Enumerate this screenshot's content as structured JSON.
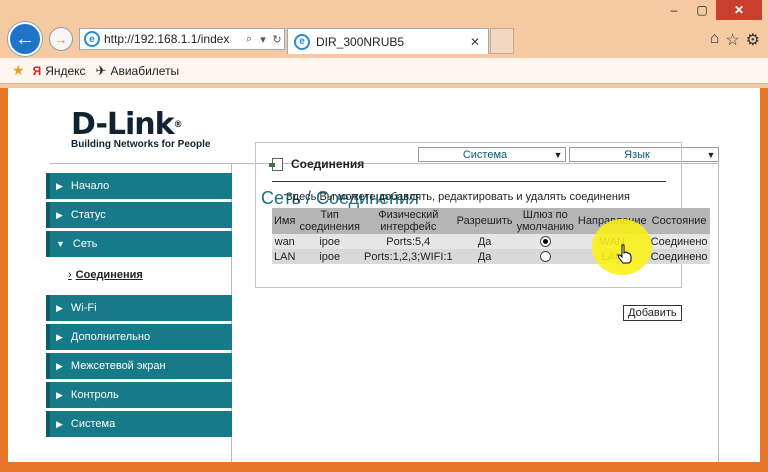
{
  "browser": {
    "url": "http://192.168.1.1/index",
    "tab_title": "DIR_300NRUB5",
    "favorites": [
      "Яндекс",
      "Авиабилеты"
    ]
  },
  "logo": {
    "brand": "D-Link",
    "tagline": "Building Networks for People"
  },
  "selects": {
    "system": "Система",
    "language": "Язык"
  },
  "sidebar": {
    "items": [
      {
        "label": "Начало"
      },
      {
        "label": "Статус"
      },
      {
        "label": "Сеть"
      },
      {
        "label": "Wi-Fi"
      },
      {
        "label": "Дополнительно"
      },
      {
        "label": "Межсетевой экран"
      },
      {
        "label": "Контроль"
      },
      {
        "label": "Система"
      }
    ],
    "subitem": "Соединения"
  },
  "page_heading": "Сеть  / Соединения",
  "panel": {
    "title": "Соединения",
    "description": "Здесь Вы можете добавлять, редактировать и удалять соединения"
  },
  "table": {
    "headers": [
      "Имя",
      "Тип соединения",
      "Физический интерфейс",
      "Разрешить",
      "Шлюз по умолчанию",
      "Направление",
      "Состояние"
    ],
    "rows": [
      {
        "name": "wan",
        "type": "ipoe",
        "iface": "Ports:5,4",
        "enabled": "Да",
        "gateway": true,
        "direction": "WAN",
        "state": "Соединено"
      },
      {
        "name": "LAN",
        "type": "ipoe",
        "iface": "Ports:1,2,3;WIFI:1",
        "enabled": "Да",
        "gateway": false,
        "direction": "LAN",
        "state": "Соединено"
      }
    ]
  },
  "add_button": "Добавить"
}
